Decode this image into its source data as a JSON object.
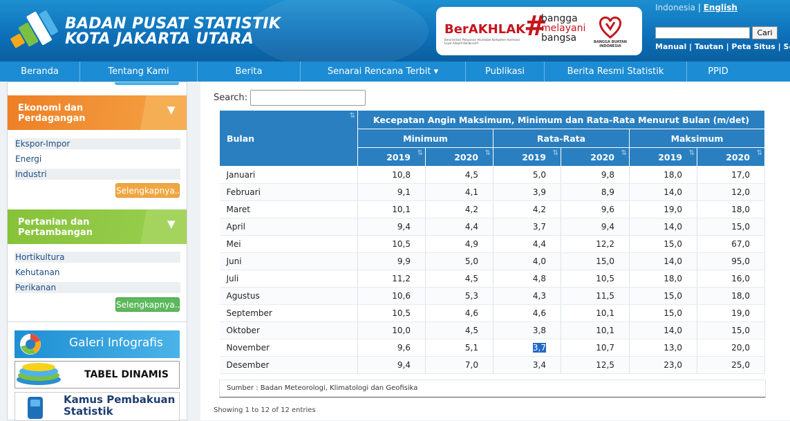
{
  "header": {
    "title_line1": "BADAN PUSAT STATISTIK",
    "title_line2": "KOTA JAKARTA UTARA",
    "banner": {
      "berakhlak": "BerAKHLAK",
      "berakhlak_sub": "Berorientasi Pelayanan Akuntabel Kompeten Harmonis Loyal Adaptif Kolaboratif",
      "hash": "#",
      "bangga": "bangga",
      "melayani": "melayani",
      "bangsa": "bangsa",
      "bbi": "BANGGA BUATAN INDONESIA"
    },
    "lang_indonesia": "Indonesia",
    "lang_sep": " | ",
    "lang_english": "English",
    "search_button": "Cari",
    "top_links": "Manual | Tautan | Peta Situs | S&K"
  },
  "nav": {
    "items": [
      "Beranda",
      "Tentang Kami",
      "Berita",
      "Senarai Rencana Terbit ▾",
      "Publikasi",
      "Berita Resmi Statistik",
      "PPID"
    ]
  },
  "sidebar": {
    "cat1": {
      "title_line1": "Ekonomi dan",
      "title_line2": "Perdagangan",
      "arrow": "▼",
      "links": [
        "Ekspor-Impor",
        "Energi",
        "Industri"
      ],
      "more": "Selengkapnya...",
      "color": "#ef8a2e",
      "more_color": "#f0a742"
    },
    "cat2": {
      "title_line1": "Pertanian dan",
      "title_line2": "Pertambangan",
      "arrow": "▼",
      "links": [
        "Hortikultura",
        "Kehutanan",
        "Perikanan"
      ],
      "more": "Selengkapnya...",
      "color": "#8cc63f",
      "more_color": "#5cb85c"
    },
    "banners": {
      "galeri": "Galeri Infografis",
      "tabel": "TABEL DINAMIS",
      "kamus_line1": "Kamus Pembakuan",
      "kamus_line2": "Statistik"
    }
  },
  "content": {
    "search_label": "Search:",
    "search_value": "",
    "table": {
      "main_header": "Kecepatan Angin Maksimum, Minimum dan Rata-Rata Menurut Bulan (m/det)",
      "row_header": "Bulan",
      "groups": [
        "Minimum",
        "Rata-Rata",
        "Maksimum"
      ],
      "years": [
        "2019",
        "2020",
        "2019",
        "2020",
        "2019",
        "2020"
      ],
      "rows": [
        {
          "month": "Januari",
          "vals": [
            "10,8",
            "4,5",
            "5,0",
            "9,8",
            "18,0",
            "17,0"
          ]
        },
        {
          "month": "Februari",
          "vals": [
            "9,1",
            "4,1",
            "3,9",
            "8,9",
            "14,0",
            "12,0"
          ]
        },
        {
          "month": "Maret",
          "vals": [
            "10,1",
            "4,2",
            "4,2",
            "9,6",
            "19,0",
            "18,0"
          ]
        },
        {
          "month": "April",
          "vals": [
            "9,4",
            "4,4",
            "3,7",
            "9,4",
            "14,0",
            "15,0"
          ]
        },
        {
          "month": "Mei",
          "vals": [
            "10,5",
            "4,9",
            "4,4",
            "12,2",
            "15,0",
            "67,0"
          ]
        },
        {
          "month": "Juni",
          "vals": [
            "9,9",
            "5,0",
            "4,0",
            "15,0",
            "14,0",
            "95,0"
          ]
        },
        {
          "month": "Juli",
          "vals": [
            "11,2",
            "4,5",
            "4,8",
            "10,5",
            "18,0",
            "16,0"
          ]
        },
        {
          "month": "Agustus",
          "vals": [
            "10,6",
            "5,3",
            "4,3",
            "11,5",
            "15,0",
            "18,0"
          ]
        },
        {
          "month": "September",
          "vals": [
            "10,5",
            "4,6",
            "4,6",
            "10,1",
            "15,0",
            "19,0"
          ]
        },
        {
          "month": "Oktober",
          "vals": [
            "10,0",
            "4,5",
            "3,8",
            "10,1",
            "14,0",
            "15,0"
          ]
        },
        {
          "month": "November",
          "vals": [
            "9,6",
            "5,1",
            "3,7",
            "10,7",
            "13,0",
            "20,0"
          ]
        },
        {
          "month": "Desember",
          "vals": [
            "9,4",
            "7,0",
            "3,4",
            "12,5",
            "23,0",
            "25,0"
          ]
        }
      ],
      "highlight": {
        "row": 10,
        "col": 2
      }
    },
    "source": "Sumber : Badan Meteorologi, Klimatologi dan Geofisika",
    "showing": "Showing 1 to 12 of 12 entries"
  }
}
